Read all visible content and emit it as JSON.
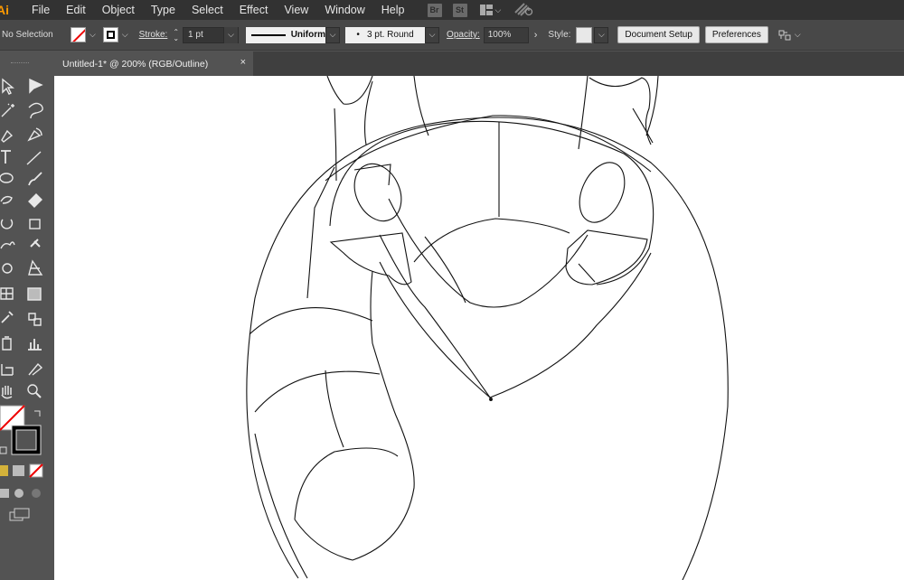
{
  "app": {
    "logo": "Ai"
  },
  "menu": [
    "File",
    "Edit",
    "Object",
    "Type",
    "Select",
    "Effect",
    "View",
    "Window",
    "Help"
  ],
  "badges": {
    "bridge": "Br",
    "stock": "St"
  },
  "control": {
    "selection": "No Selection",
    "stroke_label": "Stroke:",
    "stroke_weight": "1 pt",
    "profile": "Uniform",
    "brush": "3 pt. Round",
    "opacity_label": "Opacity:",
    "opacity_value": "100%",
    "style_label": "Style:",
    "document_setup": "Document Setup",
    "preferences": "Preferences"
  },
  "document": {
    "tab_title": "Untitled-1* @ 200% (RGB/Outline)",
    "close": "×"
  },
  "colors": {
    "accent": "#ff9a00",
    "chrome_dark": "#323232",
    "chrome": "#535353",
    "canvas": "#ffffff"
  }
}
